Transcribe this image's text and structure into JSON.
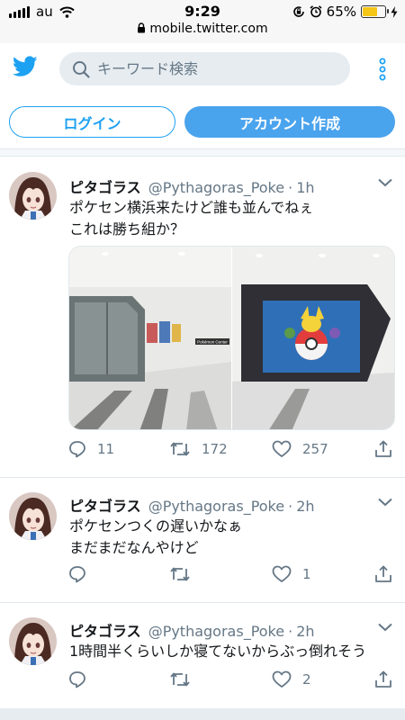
{
  "status_bar": {
    "carrier": "au",
    "time": "9:29",
    "url": "mobile.twitter.com",
    "battery": "65%"
  },
  "header": {
    "search_placeholder": "キーワード検索"
  },
  "auth": {
    "login_label": "ログイン",
    "signup_label": "アカウント作成"
  },
  "tweets": [
    {
      "name": "ピタゴラス",
      "handle": "@Pythagoras_Poke",
      "dot": "·",
      "time": "1h",
      "text_line1": "ポケセン横浜来たけど誰も並んでねぇ",
      "text_line2": "これは勝ち組か？",
      "has_media": true,
      "media_sign": "Pokémon Center",
      "replies": "11",
      "retweets": "172",
      "likes": "257"
    },
    {
      "name": "ピタゴラス",
      "handle": "@Pythagoras_Poke",
      "dot": "·",
      "time": "2h",
      "text_line1": "ポケセンつくの遅いかなぁ",
      "text_line2": "まだまだなんやけど",
      "replies": "",
      "retweets": "",
      "likes": "1"
    },
    {
      "name": "ピタゴラス",
      "handle": "@Pythagoras_Poke",
      "dot": "·",
      "time": "2h",
      "text_line1": "1時間半くらいしか寝てないからぶっ倒れそう",
      "replies": "",
      "retweets": "",
      "likes": "2"
    }
  ],
  "colors": {
    "brand": "#1da1f2",
    "signup_bg": "#4aa3ed",
    "muted": "#657786",
    "search_bg": "#e6ecf0",
    "battery": "#f5c518"
  },
  "icons": [
    "signal-icon",
    "wifi-icon",
    "lock-icon",
    "rotation-lock-icon",
    "alarm-icon",
    "battery-icon",
    "charging-icon",
    "twitter-logo-icon",
    "search-icon",
    "more-icon",
    "chevron-down-icon",
    "reply-icon",
    "retweet-icon",
    "like-icon",
    "share-icon"
  ]
}
